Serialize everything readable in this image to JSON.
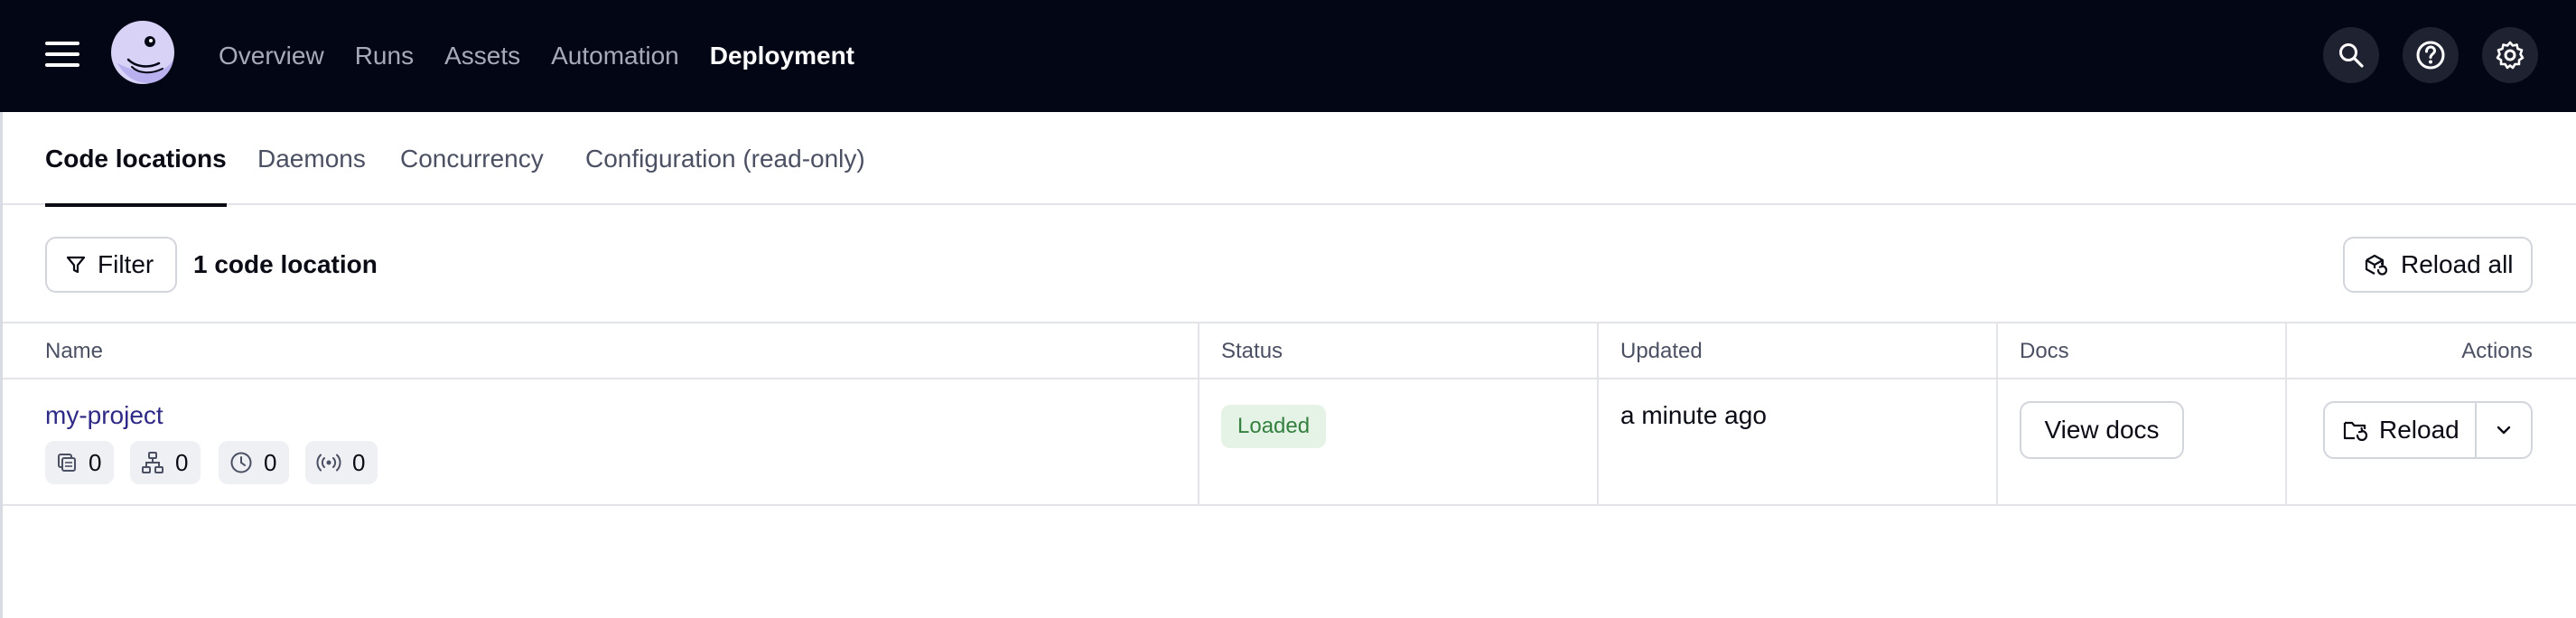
{
  "app": {
    "logo_name": "dagster-logo"
  },
  "nav": {
    "items": [
      {
        "label": "Overview",
        "active": false
      },
      {
        "label": "Runs",
        "active": false
      },
      {
        "label": "Assets",
        "active": false
      },
      {
        "label": "Automation",
        "active": false
      },
      {
        "label": "Deployment",
        "active": true
      }
    ],
    "right_icons": [
      "search-icon",
      "help-icon",
      "settings-icon"
    ]
  },
  "tabs": [
    {
      "label": "Code locations",
      "active": true
    },
    {
      "label": "Daemons",
      "active": false
    },
    {
      "label": "Concurrency",
      "active": false
    },
    {
      "label": "Configuration (read-only)",
      "active": false
    }
  ],
  "toolbar": {
    "filter_label": "Filter",
    "count_label": "1 code location",
    "reload_all_label": "Reload all"
  },
  "table": {
    "columns": [
      "Name",
      "Status",
      "Updated",
      "Docs",
      "Actions"
    ],
    "rows": [
      {
        "name": "my-project",
        "counts": [
          {
            "icon": "asset-group-icon",
            "value": "0"
          },
          {
            "icon": "job-icon",
            "value": "0"
          },
          {
            "icon": "schedule-icon",
            "value": "0"
          },
          {
            "icon": "sensor-icon",
            "value": "0"
          }
        ],
        "status": "Loaded",
        "updated": "a minute ago",
        "docs_label": "View docs",
        "reload_label": "Reload"
      }
    ]
  },
  "colors": {
    "topbar_bg": "#030615",
    "link": "#2e2a86",
    "status_loaded_bg": "#e5f3e7",
    "status_loaded_text": "#33803f"
  }
}
